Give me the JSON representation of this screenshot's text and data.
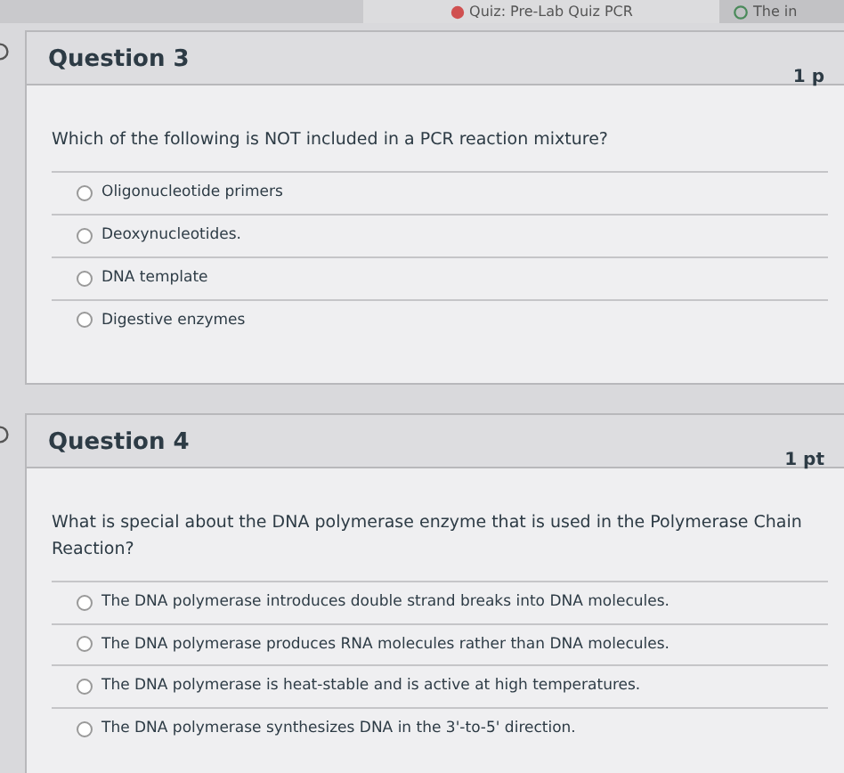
{
  "browser_tabs": [
    {
      "label": "Quiz: Pre-Lab Quiz PCR",
      "kind": "quiz",
      "selected": true
    },
    {
      "label": "The in",
      "kind": "google",
      "selected": false
    }
  ],
  "questions": [
    {
      "title": "Question 3",
      "points": "1 p",
      "prompt": "Which of the following is NOT included in a  PCR reaction mixture?",
      "answers": [
        {
          "label": "Oligonucleotide primers",
          "selected": false
        },
        {
          "label": "Deoxynucleotides.",
          "selected": false
        },
        {
          "label": "DNA template",
          "selected": false
        },
        {
          "label": "Digestive enzymes",
          "selected": false
        }
      ]
    },
    {
      "title": "Question 4",
      "points": "1 pt",
      "prompt": "What is special about the DNA polymerase enzyme that is used in the Polymerase Chain Reaction?",
      "answers": [
        {
          "label": "The DNA polymerase introduces double strand breaks into DNA molecules.",
          "selected": false
        },
        {
          "label": "The DNA polymerase produces RNA molecules rather than DNA molecules.",
          "selected": false
        },
        {
          "label": "The DNA polymerase is heat-stable and is active at high temperatures.",
          "selected": false
        },
        {
          "label": "The DNA polymerase synthesizes DNA in the 3'-to-5' direction.",
          "selected": false
        }
      ]
    }
  ]
}
